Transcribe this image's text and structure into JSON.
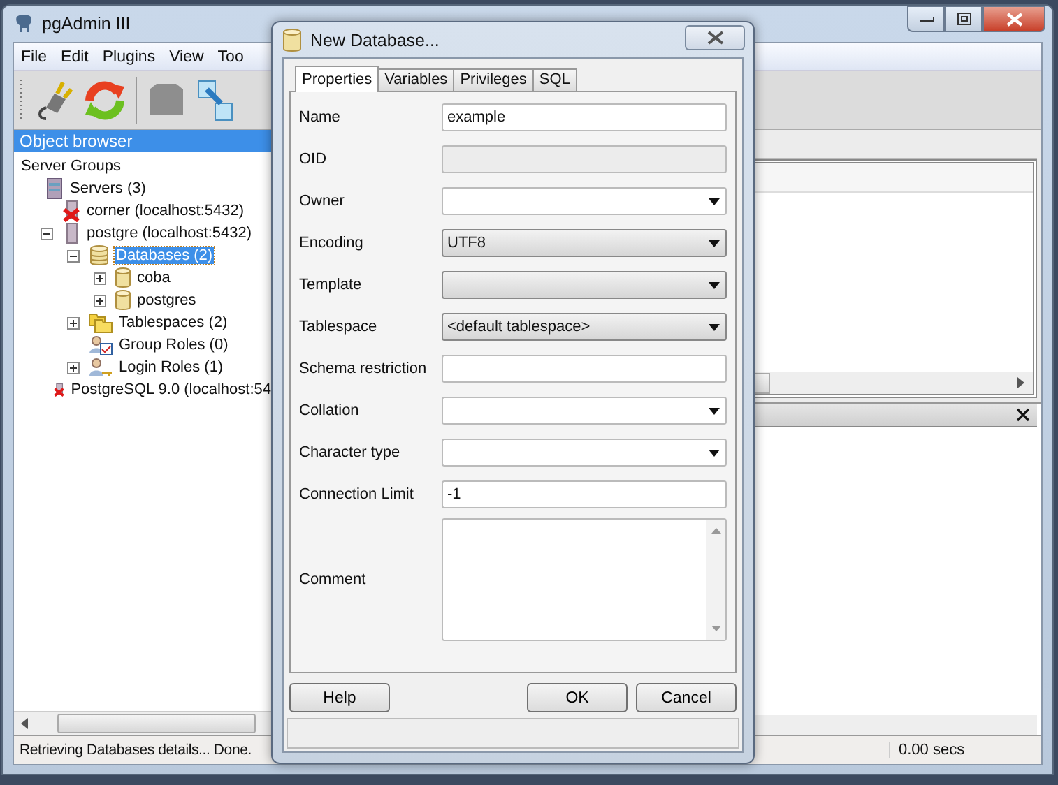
{
  "window": {
    "title": "pgAdmin III"
  },
  "menu": [
    "File",
    "Edit",
    "Plugins",
    "View",
    "Too"
  ],
  "object_browser": {
    "title": "Object browser",
    "tree": [
      {
        "label": "Server Groups",
        "children": [
          {
            "label": "Servers (3)",
            "kind": "servers",
            "children": [
              {
                "label": "corner (localhost:5432)",
                "kind": "server-down"
              },
              {
                "label": "postgre (localhost:5432)",
                "kind": "server",
                "expanded": true,
                "children": [
                  {
                    "label": "Databases (2)",
                    "kind": "databases",
                    "expanded": true,
                    "selected": true,
                    "children": [
                      {
                        "label": "coba",
                        "kind": "database",
                        "expanded": false,
                        "selected": false
                      },
                      {
                        "label": "postgres",
                        "kind": "database",
                        "expanded": false,
                        "selected": false
                      }
                    ]
                  },
                  {
                    "label": "Tablespaces (2)",
                    "kind": "tablespaces",
                    "expanded": false,
                    "selected": false
                  },
                  {
                    "label": "Group Roles (0)",
                    "kind": "group-roles",
                    "selected": false
                  },
                  {
                    "label": "Login Roles (1)",
                    "kind": "login-roles",
                    "expanded": false,
                    "selected": false
                  }
                ]
              },
              {
                "label": "PostgreSQL 9.0 (localhost:54",
                "kind": "server-down"
              }
            ]
          }
        ]
      }
    ]
  },
  "status_bar": {
    "message": "Retrieving Databases details... Done.",
    "time": "0.00 secs"
  },
  "dialog": {
    "title": "New Database...",
    "tabs": [
      {
        "label": "Properties",
        "selected": true
      },
      {
        "label": "Variables",
        "selected": false
      },
      {
        "label": "Privileges",
        "selected": false
      },
      {
        "label": "SQL",
        "selected": false
      }
    ],
    "fields": [
      {
        "label": "Name",
        "kind": "text",
        "value": "example"
      },
      {
        "label": "OID",
        "kind": "readonly"
      },
      {
        "label": "Owner",
        "kind": "combo"
      },
      {
        "label": "Encoding",
        "kind": "dropdown",
        "value": "UTF8"
      },
      {
        "label": "Template",
        "kind": "dropdown"
      },
      {
        "label": "Tablespace",
        "kind": "dropdown",
        "value": "<default tablespace>"
      },
      {
        "label": "Schema restriction",
        "kind": "text"
      },
      {
        "label": "Collation",
        "kind": "combo"
      },
      {
        "label": "Character type",
        "kind": "combo"
      },
      {
        "label": "Connection Limit",
        "kind": "text",
        "value": "-1"
      },
      {
        "label": "Comment",
        "kind": "textarea"
      }
    ],
    "buttons": [
      "Help",
      "OK",
      "Cancel"
    ]
  }
}
